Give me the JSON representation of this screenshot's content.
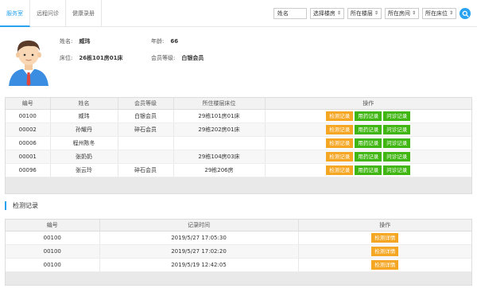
{
  "tabs": [
    {
      "label": "服务室",
      "active": true
    },
    {
      "label": "远程问诊",
      "active": false
    },
    {
      "label": "健康录册",
      "active": false
    }
  ],
  "filters": {
    "name_placeholder": "姓名",
    "selects": [
      "选择楼房",
      "所在楼层",
      "所在房间",
      "所在床位"
    ]
  },
  "profile": {
    "name_label": "姓名:",
    "name_value": "威玮",
    "age_label": "年龄:",
    "age_value": "66",
    "bed_label": "床位:",
    "bed_value": "26栋101房01床",
    "level_label": "会员等级:",
    "level_value": "白银会员"
  },
  "members_table": {
    "headers": [
      "编号",
      "姓名",
      "会员等级",
      "所住楼层床位",
      "操作"
    ],
    "action_labels": [
      "检测记录",
      "用药记录",
      "问诊记录"
    ],
    "rows": [
      {
        "id": "00100",
        "name": "威玮",
        "level": "白银会员",
        "bed": "29栋101房01床"
      },
      {
        "id": "00002",
        "name": "孙耀丹",
        "level": "碎石会员",
        "bed": "29栋202房01床"
      },
      {
        "id": "00006",
        "name": "程州陈冬",
        "level": "",
        "bed": ""
      },
      {
        "id": "00001",
        "name": "张奶奶",
        "level": "",
        "bed": "29栋104房03床"
      },
      {
        "id": "00096",
        "name": "张云玲",
        "level": "碎石会员",
        "bed": "29栋206房"
      }
    ]
  },
  "records_section": {
    "title": "检测记录",
    "headers": [
      "编号",
      "记录时间",
      "操作"
    ],
    "action_label": "检测详情",
    "rows": [
      {
        "id": "00100",
        "time": "2019/5/27 17:05:30"
      },
      {
        "id": "00100",
        "time": "2019/5/27 17:02:20"
      },
      {
        "id": "00100",
        "time": "2019/5/19 12:42:05"
      }
    ]
  },
  "colors": {
    "accent": "#29a3f0",
    "orange_button": "#f5a623",
    "green_button": "#3fb611"
  },
  "icons": {
    "search": "search-icon",
    "avatar": "avatar"
  }
}
